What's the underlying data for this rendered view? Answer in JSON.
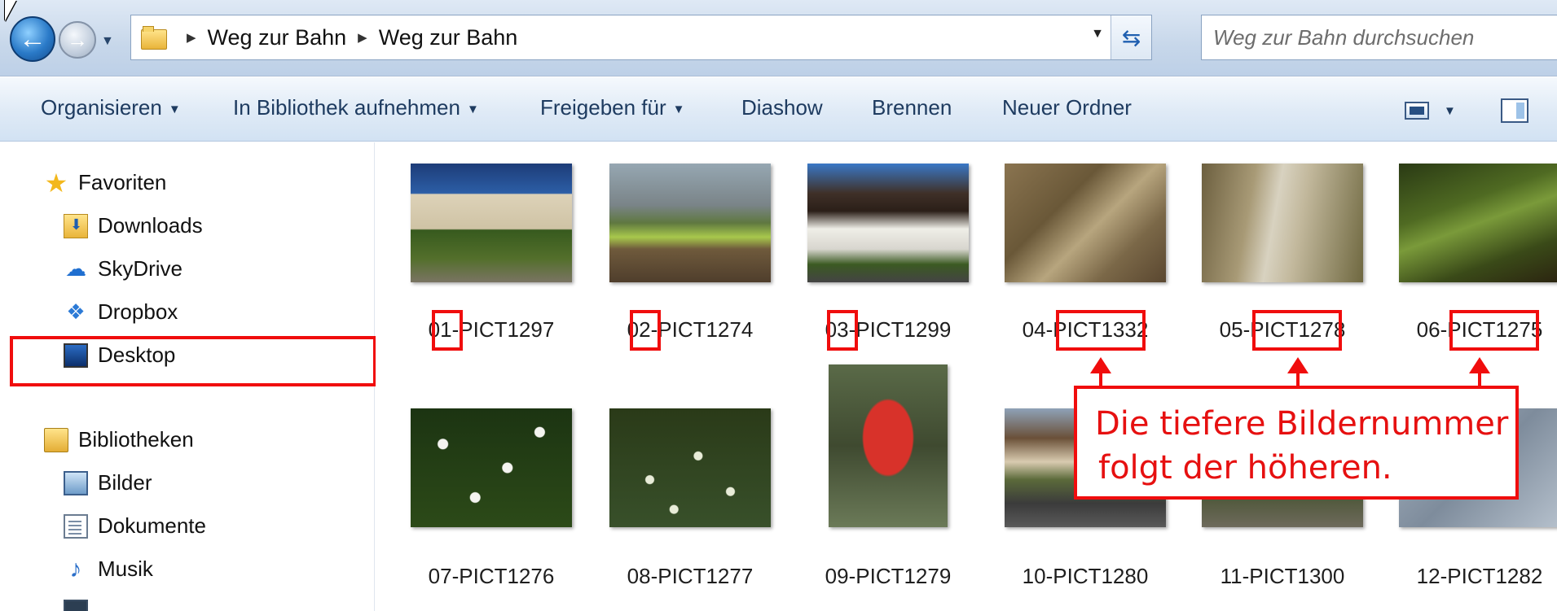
{
  "address": {
    "crumbs": [
      "Weg zur Bahn",
      "Weg zur Bahn"
    ],
    "search_placeholder": "Weg zur Bahn durchsuchen"
  },
  "toolbar": {
    "organize": "Organisieren",
    "include_library": "In Bibliothek aufnehmen",
    "share_with": "Freigeben für",
    "slideshow": "Diashow",
    "burn": "Brennen",
    "new_folder": "Neuer Ordner"
  },
  "sidebar": {
    "favorites": "Favoriten",
    "downloads": "Downloads",
    "skydrive": "SkyDrive",
    "dropbox": "Dropbox",
    "desktop": "Desktop",
    "libraries": "Bibliotheken",
    "pictures": "Bilder",
    "documents": "Dokumente",
    "music": "Musik"
  },
  "files": [
    "01-PICT1297",
    "02-PICT1274",
    "03-PICT1299",
    "04-PICT1332",
    "05-PICT1278",
    "06-PICT1275",
    "07-PICT1276",
    "08-PICT1277",
    "09-PICT1279",
    "10-PICT1280",
    "11-PICT1300",
    "12-PICT1282"
  ],
  "annotation": {
    "line1": "Die tiefere Bildernummer",
    "line2": "folgt der höheren."
  },
  "colors": {
    "annotation_red": "#f00d0d",
    "toolbar_text": "#1e3b60"
  }
}
